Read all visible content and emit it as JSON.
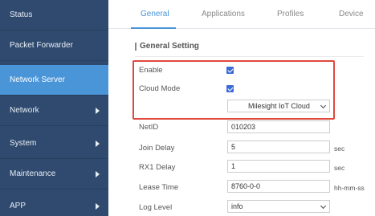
{
  "sidebar": {
    "items": [
      {
        "label": "Status",
        "has_arrow": false
      },
      {
        "label": "Packet Forwarder",
        "has_arrow": false
      },
      {
        "label": "Network Server",
        "has_arrow": false
      },
      {
        "label": "Network",
        "has_arrow": true
      },
      {
        "label": "System",
        "has_arrow": true
      },
      {
        "label": "Maintenance",
        "has_arrow": true
      },
      {
        "label": "APP",
        "has_arrow": true
      }
    ],
    "active": "Network Server"
  },
  "tabs": [
    "General",
    "Applications",
    "Profiles",
    "Device"
  ],
  "active_tab": "General",
  "section": {
    "title": "General Setting"
  },
  "form": {
    "enable": {
      "label": "Enable",
      "checked": true
    },
    "cloud_mode": {
      "label": "Cloud Mode",
      "checked": true
    },
    "cloud_select": {
      "value": "Milesight IoT Cloud"
    },
    "netid": {
      "label": "NetID",
      "value": "010203"
    },
    "join_delay": {
      "label": "Join Delay",
      "value": "5",
      "unit": "sec"
    },
    "rx1_delay": {
      "label": "RX1 Delay",
      "value": "1",
      "unit": "sec"
    },
    "lease_time": {
      "label": "Lease Time",
      "value": "8760-0-0",
      "unit": "hh-mm-ss"
    },
    "log_level": {
      "label": "Log Level",
      "value": "info"
    }
  },
  "colors": {
    "sidebar_bg": "#2f4a6e",
    "active_item": "#4a95d8",
    "accent": "#4a95d8",
    "checkbox": "#3c6bd6",
    "highlight_border": "#e0483e"
  }
}
